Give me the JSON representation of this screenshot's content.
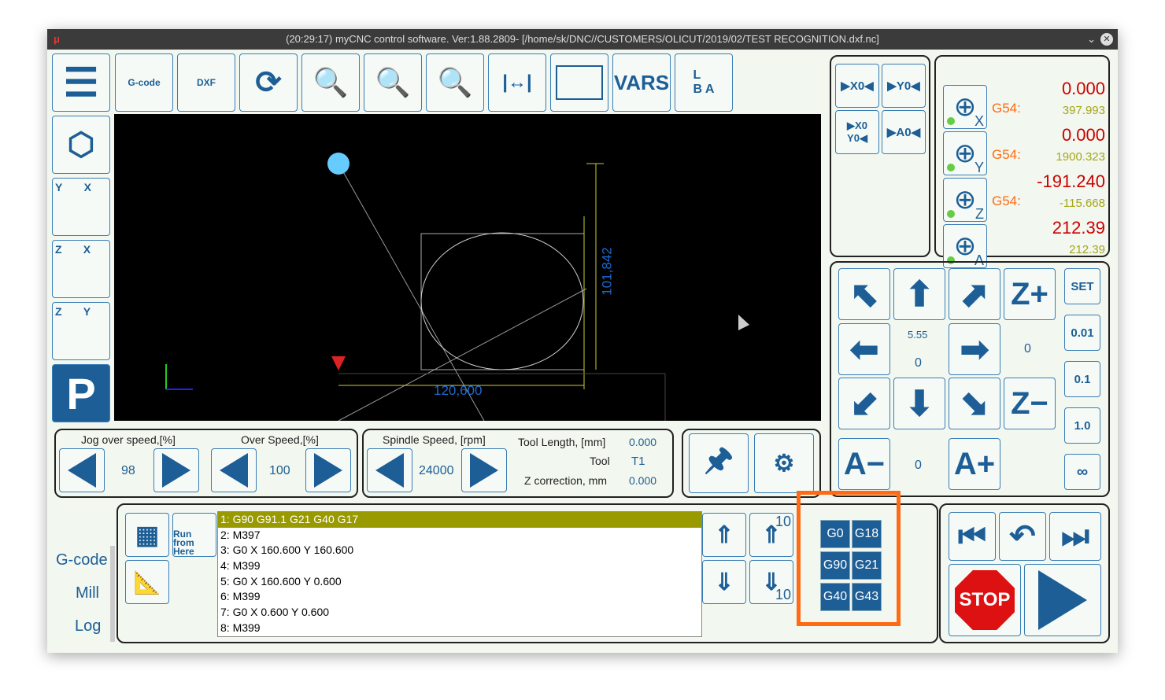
{
  "title": "(20:29:17) myCNC control software. Ver:1.88.2809- [/home/sk/DNC//CUSTOMERS/OLICUT/2019/02/TEST RECOGNITION.dxf.nc]",
  "toolbar": {
    "vars": "VARS",
    "gcode": "G-code",
    "dxf": "DXF"
  },
  "views": {
    "p": "P"
  },
  "canvas": {
    "dim_h": "120,600",
    "dim_v": "101,842"
  },
  "zero_buttons": [
    "▶X0◀",
    "▶Y0◀",
    "▶X0 Y0◀",
    "▶A0◀"
  ],
  "coords": [
    {
      "axis": "X",
      "label": "G54:",
      "value": "0.000",
      "machine": "397.993"
    },
    {
      "axis": "Y",
      "label": "G54:",
      "value": "0.000",
      "machine": "1900.323"
    },
    {
      "axis": "Z",
      "label": "G54:",
      "value": "-191.240",
      "machine": "-115.668"
    },
    {
      "axis": "A",
      "label": "",
      "value": "212.39",
      "machine": "212.39"
    }
  ],
  "jog": {
    "z_plus": "Z+",
    "z_minus": "Z−",
    "a_minus": "A−",
    "a_plus": "A+",
    "step": "5.55",
    "center_val": "0",
    "right_val": "0",
    "a_val": "0",
    "set": "SET",
    "steps": [
      "0.01",
      "0.1",
      "1.0",
      "∞"
    ]
  },
  "speeds": {
    "jog_label": "Jog over speed,[%]",
    "jog_value": "98",
    "over_label": "Over Speed,[%]",
    "over_value": "100",
    "spindle_label": "Spindle Speed, [rpm]",
    "spindle_value": "24000",
    "tool_length_label": "Tool Length, [mm]",
    "tool_length": "0.000",
    "tool_label": "Tool",
    "tool": "T1",
    "zcorr_label": "Z correction, mm",
    "zcorr": "0.000"
  },
  "side_tabs": [
    "G-code",
    "Mill",
    "Log"
  ],
  "run_from_here": "Run from Here",
  "gcode_lines": [
    "1: G90 G91.1 G21 G40 G17",
    "2: M397",
    "3: G0 X 160.600 Y 160.600",
    "4: M399",
    "5: G0 X 160.600 Y 0.600",
    "6: M399",
    "7: G0 X 0.600 Y 0.600",
    "8: M399"
  ],
  "scroll_step": "10",
  "gcodes": [
    "G0",
    "G18",
    "G90",
    "G21",
    "G40",
    "G43"
  ],
  "stop": "STOP",
  "colors": {
    "accent": "#1d5e96",
    "highlight": "#ff6a13",
    "selected_line": "#999900"
  }
}
